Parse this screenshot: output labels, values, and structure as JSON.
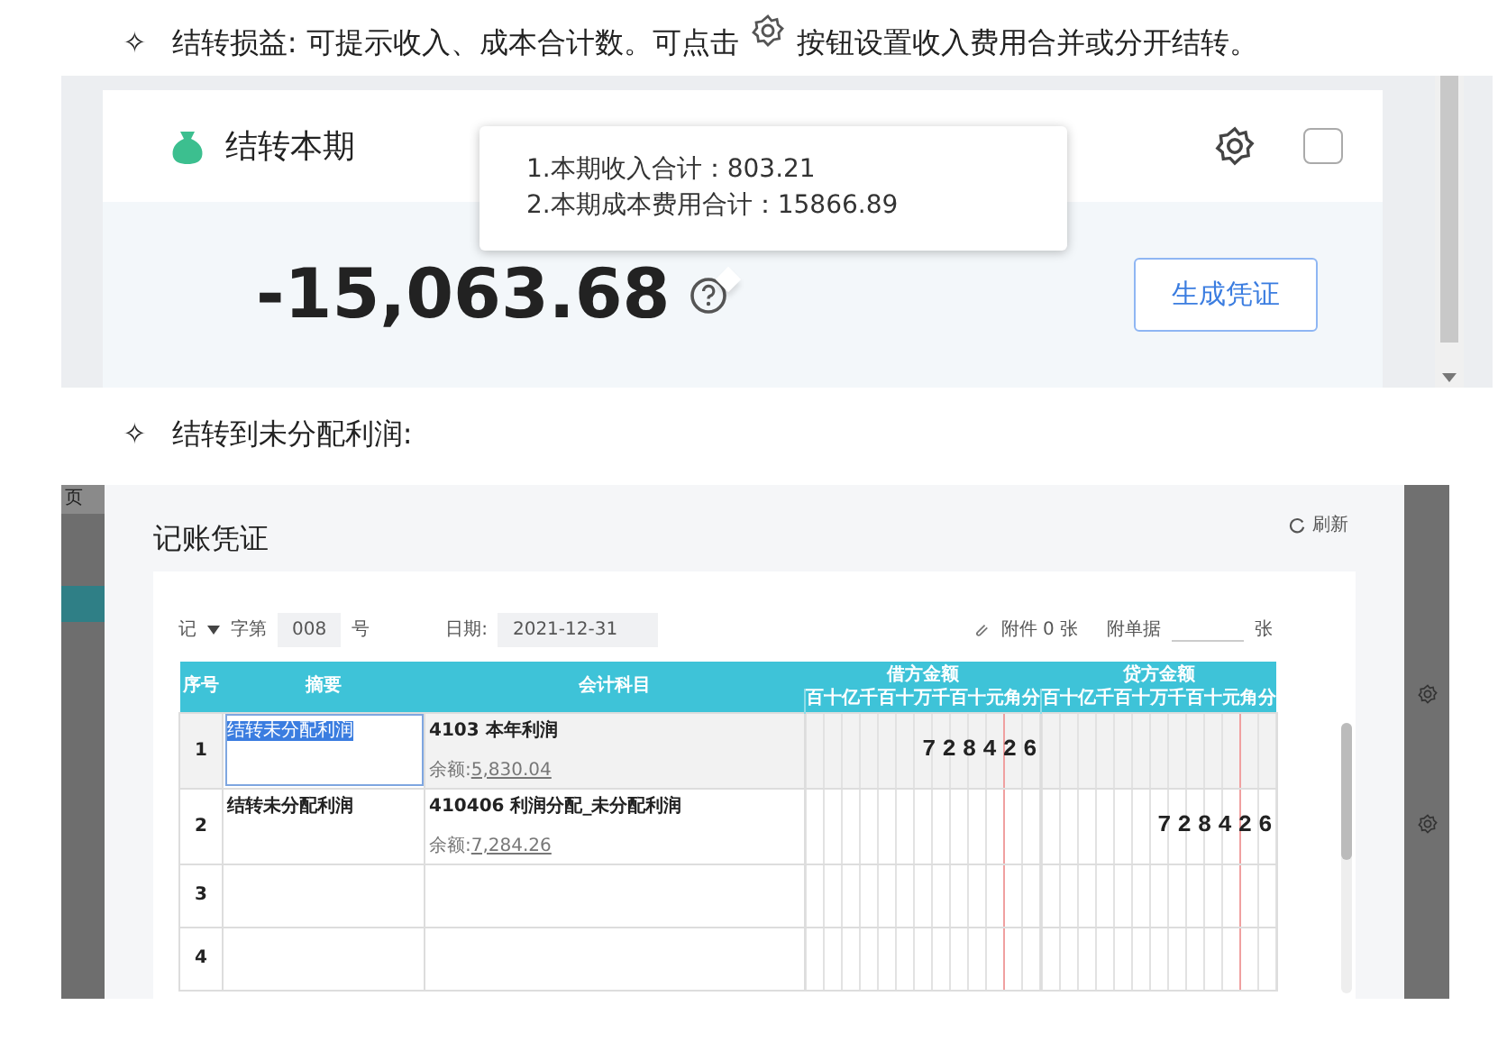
{
  "intro_1": {
    "bullet": "✧",
    "text_before": "结转损益: 可提示收入、成本合计数。可点击",
    "text_after": "按钮设置收入费用合并或分开结转。"
  },
  "closing_card": {
    "title": "结转本期",
    "checked": false,
    "amount": "-15,063.68",
    "button": "生成凭证",
    "tooltip": [
      "1.本期收入合计：803.21",
      "2.本期成本费用合计：15866.89"
    ]
  },
  "intro_2": {
    "bullet": "✧",
    "text": "结转到未分配利润:"
  },
  "voucher": {
    "background_label": "页",
    "title": "记账凭证",
    "refresh": "刷新",
    "voucher_word": "记",
    "word_label": "字第",
    "number": "008",
    "number_suffix": "号",
    "date_label": "日期:",
    "date": "2021-12-31",
    "attachment": "附件 0 张",
    "bills_label": "附单据",
    "bills_suffix": "张",
    "columns": [
      "序号",
      "摘要",
      "会计科目",
      "借方金额",
      "贷方金额"
    ],
    "debit_units": "百十亿千百十万千百十元角分",
    "credit_units": "百十亿千百十万千百十元角分",
    "rows": [
      {
        "index": "1",
        "selected": true,
        "summary": "结转未分配利润",
        "account": "4103 本年利润",
        "balance_label": "余额:",
        "balance": "5,830.04",
        "debit": "728426"
      },
      {
        "index": "2",
        "selected": false,
        "summary": "结转未分配利润",
        "account": "410406 利润分配_未分配利润",
        "balance_label": "余额:",
        "balance": "7,284.26",
        "credit": "728426"
      },
      {
        "index": "3",
        "selected": false
      },
      {
        "index": "4",
        "selected": false
      }
    ]
  }
}
